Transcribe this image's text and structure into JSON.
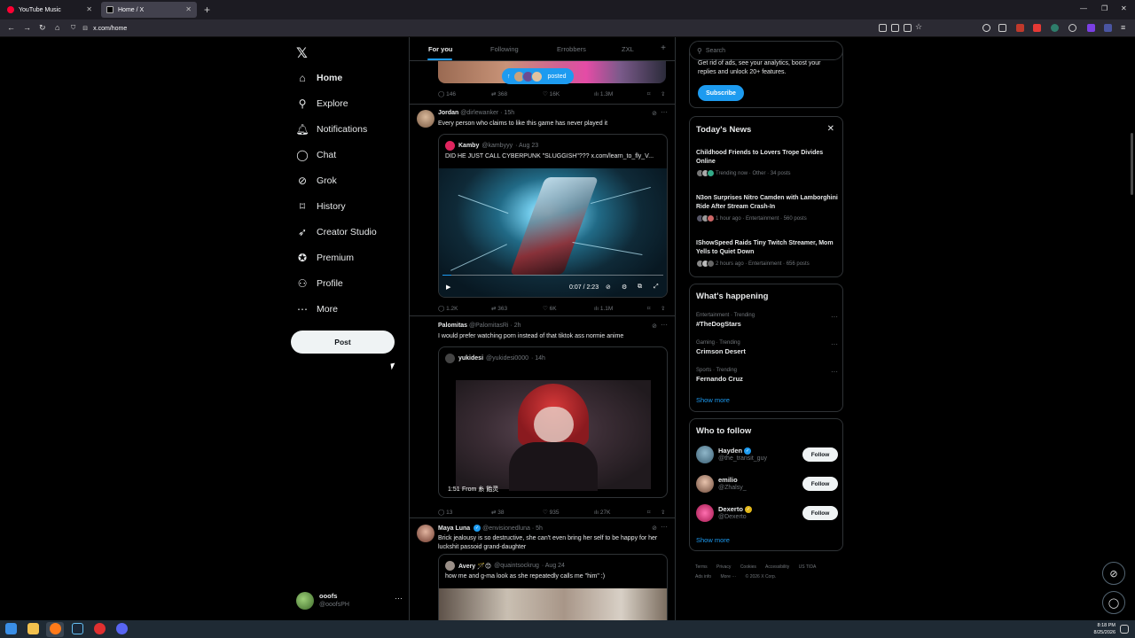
{
  "browser": {
    "tabs": [
      {
        "title": "YouTube Music",
        "active": false
      },
      {
        "title": "Home / X",
        "active": true
      }
    ],
    "url": "x.com/home"
  },
  "nav": {
    "items": [
      {
        "label": "Home",
        "icon": "home-icon"
      },
      {
        "label": "Explore",
        "icon": "search-icon"
      },
      {
        "label": "Notifications",
        "icon": "bell-icon"
      },
      {
        "label": "Chat",
        "icon": "chat-icon"
      },
      {
        "label": "Grok",
        "icon": "grok-icon"
      },
      {
        "label": "History",
        "icon": "bookmark-icon"
      },
      {
        "label": "Creator Studio",
        "icon": "rocket-icon"
      },
      {
        "label": "Premium",
        "icon": "premium-icon"
      },
      {
        "label": "Profile",
        "icon": "person-icon"
      },
      {
        "label": "More",
        "icon": "more-circle-icon"
      }
    ],
    "post_label": "Post",
    "account": {
      "name": "ooofs",
      "handle": "@ooofsPH"
    }
  },
  "feed": {
    "tabs": [
      "For you",
      "Following",
      "Errobbers",
      "ZXL"
    ],
    "posted_pill": "posted",
    "top_actions": {
      "replies": "146",
      "reposts": "368",
      "likes": "16K",
      "views": "1.3M"
    },
    "posts": [
      {
        "name": "Jordan",
        "handle": "@dirlewanker",
        "time": "· 15h",
        "text": "Every person who claims to like this game has never played it",
        "quote": {
          "name": "Kamby",
          "handle": "@kambyyy",
          "time": "· Aug 23",
          "text": "DID HE JUST CALL CYBERPUNK \"SLUGGISH\"??? x.com/learn_to_fly_V...",
          "video_time": "0:07 / 2:23"
        },
        "actions": {
          "replies": "1.2K",
          "reposts": "363",
          "likes": "6K",
          "views": "1.1M"
        }
      },
      {
        "name": "Palomitas",
        "handle": "@PalomitasRi",
        "time": "· 2h",
        "text": "I would prefer watching porn instead of that tiktok ass normie anime",
        "quote": {
          "name": "yukidesi",
          "handle": "@yukidesi0000",
          "time": "· 14h",
          "video_time": "1:51",
          "video_from": "From 糸 飴灵"
        },
        "actions": {
          "replies": "13",
          "reposts": "38",
          "likes": "935",
          "views": "27K"
        }
      },
      {
        "name": "Maya Luna",
        "handle": "@envisionedluna",
        "time": "· 5h",
        "text": "Brick jealousy is so destructive, she can't even bring her self to be happy for her luckshit passoid grand-daughter",
        "quote": {
          "name": "Avery 🪄😊",
          "handle": "@quaintsockrug",
          "time": "· Aug 24",
          "text": "how me and g-ma look as she repeatedly calls me \"him\" :)"
        }
      }
    ]
  },
  "sidebar": {
    "search_placeholder": "Search",
    "premium_text": "Get rid of ads, see your analytics, boost your replies and unlock 20+ features.",
    "subscribe_label": "Subscribe",
    "news_title": "Today's News",
    "news": [
      {
        "title": "Childhood Friends to Lovers Trope Divides Online",
        "meta": "Trending now · Other · 34 posts"
      },
      {
        "title": "N3on Surprises Nitro Camden with Lamborghini Ride After Stream Crash-In",
        "meta": "1 hour ago · Entertainment · 560 posts"
      },
      {
        "title": "IShowSpeed Raids Tiny Twitch Streamer, Mom Yells to Quiet Down",
        "meta": "2 hours ago · Entertainment · 656 posts"
      }
    ],
    "happening_title": "What's happening",
    "trends": [
      {
        "context": "Entertainment · Trending",
        "name": "#TheDogStars"
      },
      {
        "context": "Gaming · Trending",
        "name": "Crimson Desert"
      },
      {
        "context": "Sports · Trending",
        "name": "Fernando Cruz"
      }
    ],
    "show_more": "Show more",
    "who_to_follow_title": "Who to follow",
    "follow": [
      {
        "name": "Hayden",
        "handle": "@the_transit_guy",
        "badge": "blue"
      },
      {
        "name": "emilio",
        "handle": "@Zhalsy_",
        "badge": ""
      },
      {
        "name": "Dexerto",
        "handle": "@Dexerto",
        "badge": "gold"
      }
    ],
    "follow_label": "Follow",
    "footer": [
      "Terms",
      "Privacy",
      "Cookies",
      "Accessibility",
      "US TIDA",
      "Ads info",
      "More ···",
      "© 2026 X Corp."
    ]
  },
  "taskbar": {
    "time": "8:18 PM",
    "date": "8/25/2026"
  },
  "colors": {
    "accent": "#1d9bf0",
    "bg": "#000000",
    "border": "#2f3336",
    "muted": "#71767b"
  }
}
